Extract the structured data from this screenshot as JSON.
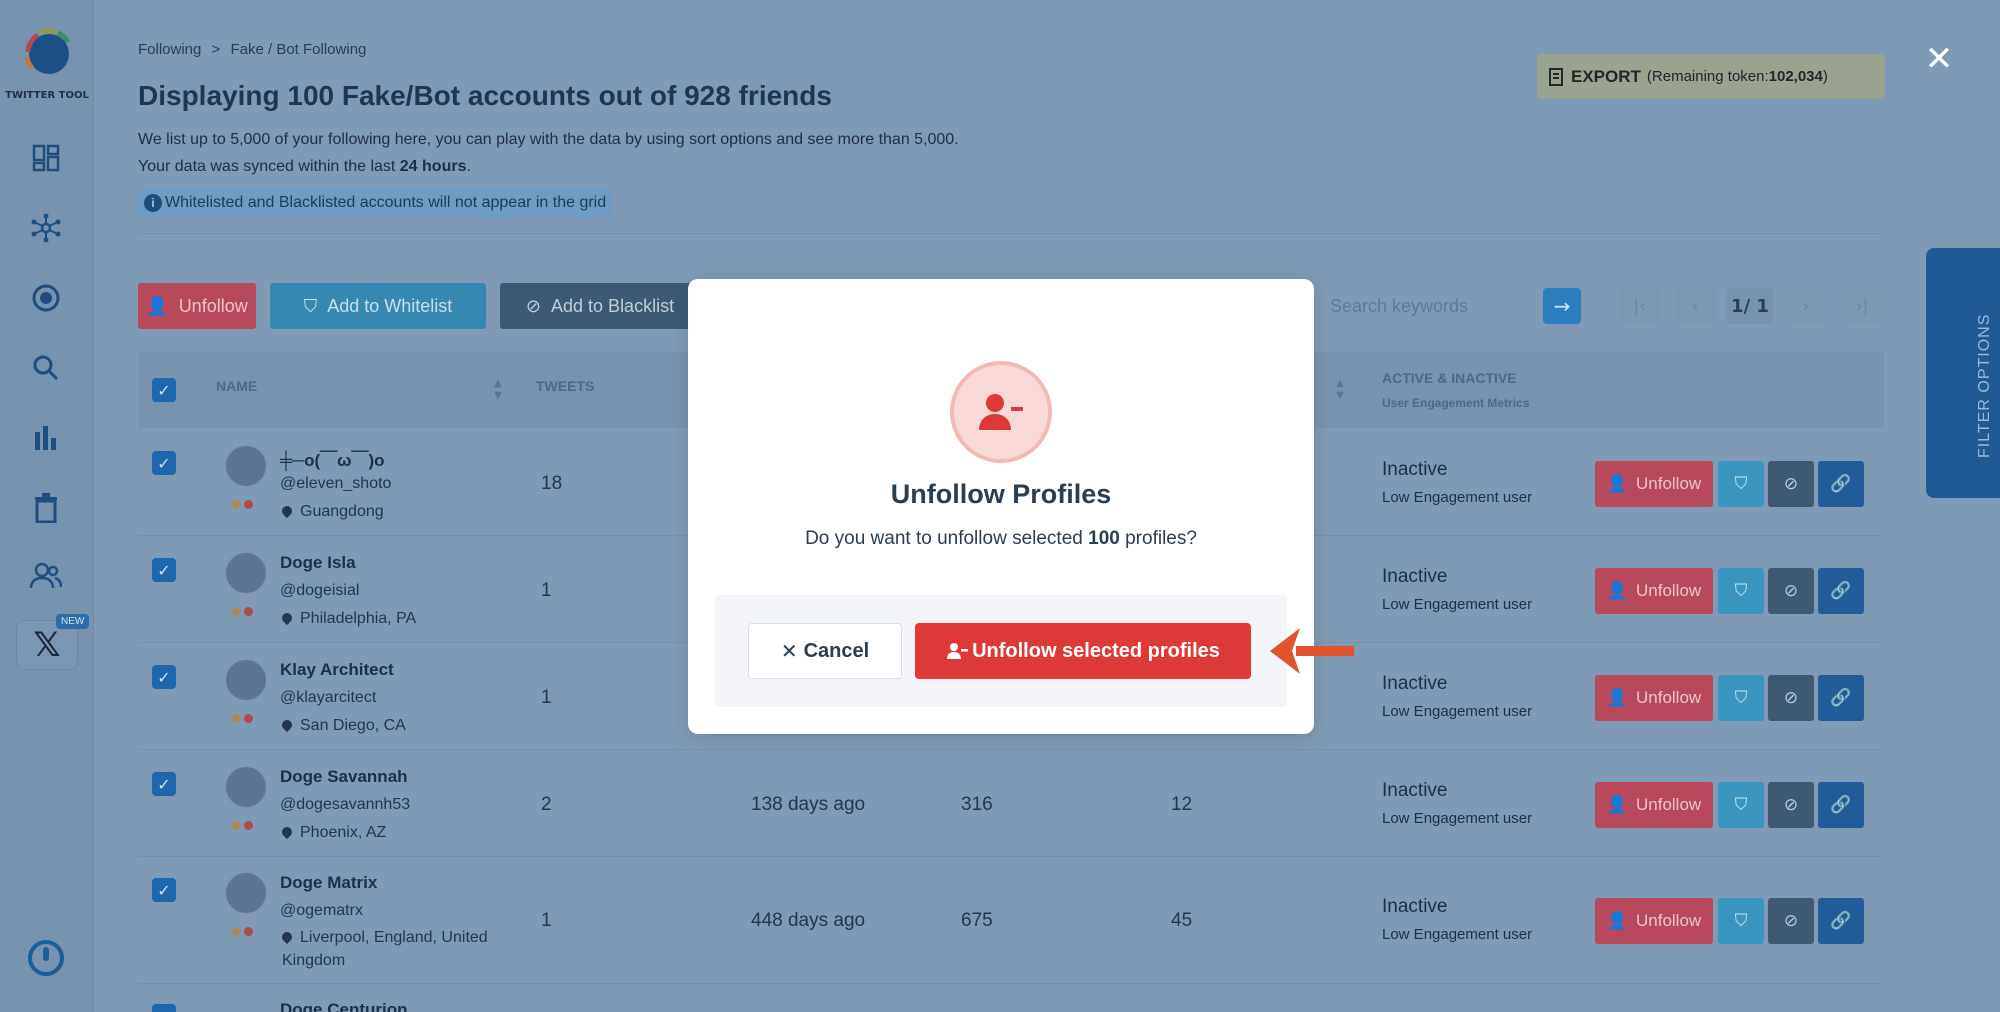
{
  "app": {
    "logo_text": "TWITTER TOOL",
    "nav_badge": "NEW"
  },
  "breadcrumb": {
    "items": [
      "Following",
      "Fake / Bot Following"
    ],
    "separator": ">"
  },
  "header": {
    "title": "Displaying 100 Fake/Bot accounts out of 928 friends",
    "desc_line1": "We list up to 5,000 of your following here, you can play with the data by using sort options and see more than 5,000.",
    "desc_line2_prefix": "Your data was synced within the last ",
    "desc_line2_bold": "24 hours",
    "desc_line2_suffix": ".",
    "notice": "Whitelisted and Blacklisted accounts will not appear in the grid"
  },
  "export": {
    "label": "EXPORT",
    "token_prefix": "(Remaining token: ",
    "token_value": "102,034",
    "token_suffix": ")"
  },
  "toolbar": {
    "unfollow_label": "Unfollow",
    "whitelist_label": "Add to Whitelist",
    "blacklist_label": "Add to Blacklist",
    "search_placeholder": "Search keywords",
    "page_indicator": "1/ 1"
  },
  "table": {
    "col_name": "NAME",
    "col_tweets": "TWEETS",
    "col_status": "ACTIVE & INACTIVE",
    "col_status_sub": "User Engagement Metrics",
    "rows": [
      {
        "name": "╪─o(￣ω￣)o",
        "handle": "@eleven_shoto",
        "location": "Guangdong",
        "tweets": "18",
        "last": "",
        "following": "",
        "followers": "",
        "status": "Inactive",
        "status_sub": "Low Engagement user",
        "unfollow": "Unfollow"
      },
      {
        "name": "Doge Isla",
        "handle": "@dogeisial",
        "location": "Philadelphia, PA",
        "tweets": "1",
        "last": "",
        "following": "",
        "followers": "",
        "status": "Inactive",
        "status_sub": "Low Engagement user",
        "unfollow": "Unfollow"
      },
      {
        "name": "Klay Architect",
        "handle": "@klayarcitect",
        "location": "San Diego, CA",
        "tweets": "1",
        "last": "",
        "following": "",
        "followers": "",
        "status": "Inactive",
        "status_sub": "Low Engagement user",
        "unfollow": "Unfollow"
      },
      {
        "name": "Doge Savannah",
        "handle": "@dogesavannh53",
        "location": "Phoenix, AZ",
        "tweets": "2",
        "last": "138 days ago",
        "following": "316",
        "followers": "12",
        "status": "Inactive",
        "status_sub": "Low Engagement user",
        "unfollow": "Unfollow"
      },
      {
        "name": "Doge Matrix",
        "handle": "@ogematrx",
        "location": "Liverpool, England, United Kingdom",
        "tweets": "1",
        "last": "448 days ago",
        "following": "675",
        "followers": "45",
        "status": "Inactive",
        "status_sub": "Low Engagement user",
        "unfollow": "Unfollow"
      },
      {
        "name": "Doge Centurion"
      }
    ]
  },
  "filter_tab": "FILTER OPTIONS",
  "modal": {
    "title": "Unfollow Profiles",
    "msg_prefix": "Do you want to unfollow selected ",
    "msg_count": "100",
    "msg_suffix": " profiles?",
    "cancel_label": "Cancel",
    "confirm_label": "Unfollow selected profiles"
  },
  "colors": {
    "accent": "#dd3a37",
    "overlay": "#7f9ab4",
    "arrow": "#e0532c"
  }
}
